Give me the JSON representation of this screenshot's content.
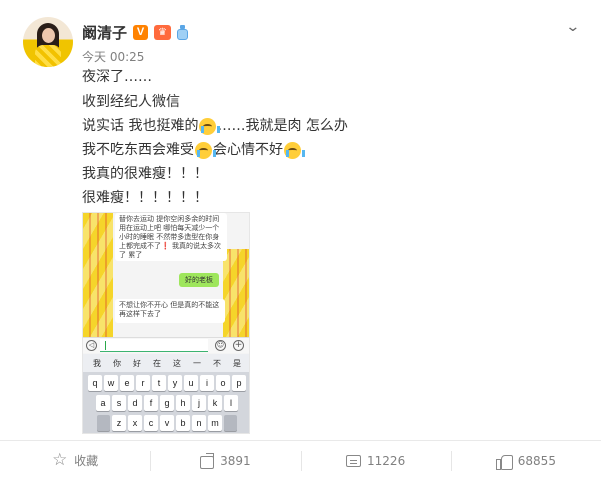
{
  "header": {
    "user_name": "阚清子",
    "verified_badge": "V",
    "timestamp": "今天 00:25",
    "menu_icon": "chevron-down-icon",
    "badge_icons": [
      "verified-v-icon",
      "crown-vip-icon",
      "bottle-badge-icon"
    ],
    "colors": {
      "verified": "#ff8200",
      "vip": "#ff6a3d"
    }
  },
  "post": {
    "lines": [
      {
        "text": "夜深了……"
      },
      {
        "text": "收到经纪人微信"
      },
      {
        "before": "说实话 我也挺难的",
        "after": "……我就是肉 怎么办"
      },
      {
        "before": "我不吃东西会难受",
        "middle": "会心情不好",
        "after": ""
      },
      {
        "text": "我真的很难瘦！！！"
      },
      {
        "text": "很难瘦！！！！！！"
      }
    ],
    "emoji_name": "crying-face-emoji"
  },
  "chat_screenshot": {
    "message_1": "替你去运动 提你空闲多余的时间用在运动上吧 哪怕每天减少一个小时的睡眠 不然带多造型在你身上都完成不了❗ 我真的说太多次了 累了",
    "reply": "好的老板",
    "message_2": "不想让你不开心 但是真的不能这再这样下去了",
    "suggestions": [
      "我",
      "你",
      "好",
      "在",
      "这",
      "一",
      "不",
      "是"
    ],
    "keyboard_rows": [
      [
        "q",
        "w",
        "e",
        "r",
        "t",
        "y",
        "u",
        "i",
        "o",
        "p"
      ],
      [
        "a",
        "s",
        "d",
        "f",
        "g",
        "h",
        "j",
        "k",
        "l"
      ],
      [
        "z",
        "x",
        "c",
        "v",
        "b",
        "n",
        "m"
      ]
    ]
  },
  "actions": {
    "favorite": {
      "label": "收藏",
      "icon": "star-icon"
    },
    "repost": {
      "label": "3891",
      "icon": "share-icon"
    },
    "comment": {
      "label": "11226",
      "icon": "comment-icon"
    },
    "like": {
      "label": "68855",
      "icon": "thumbs-up-icon"
    }
  }
}
